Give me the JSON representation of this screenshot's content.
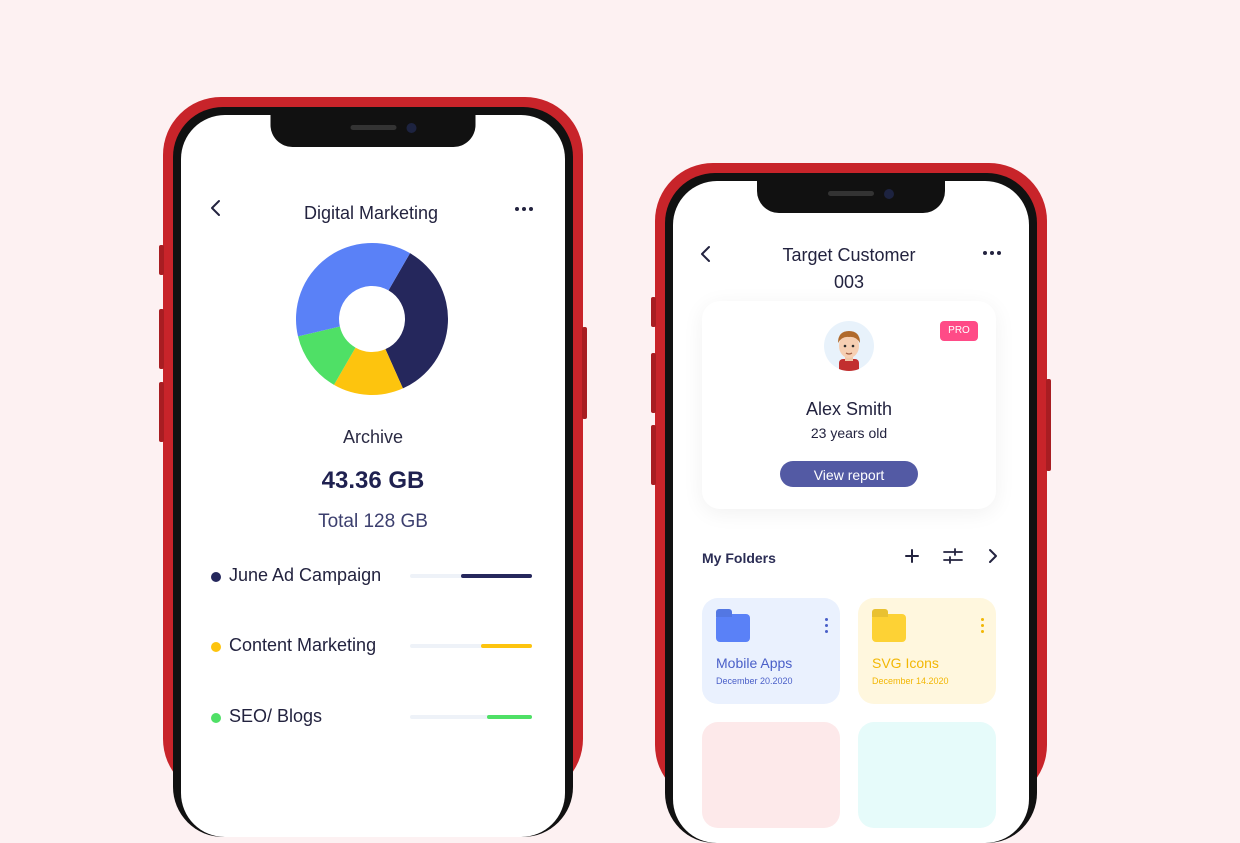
{
  "colors": {
    "background": "#fdf1f2",
    "phone_frame": "#c8242a",
    "navy": "#25275c",
    "blue": "#5a81f7",
    "yellow": "#fdc40e",
    "green": "#4fe066",
    "pro_pink": "#ff4b87",
    "button_purple": "#535aa4"
  },
  "screen1": {
    "back_icon": "chevron-left-icon",
    "title": "Digital Marketing",
    "more_icon": "more-horizontal-icon",
    "archive_label": "Archive",
    "used": "43.36 GB",
    "total": "Total 128 GB",
    "categories": [
      {
        "label": "June Ad Campaign",
        "color": "#25275c",
        "fill": 0.58
      },
      {
        "label": "Content Marketing",
        "color": "#fdc40e",
        "fill": 0.42
      },
      {
        "label": "SEO/ Blogs",
        "color": "#4fe066",
        "fill": 0.37
      }
    ]
  },
  "chart_data": {
    "type": "pie",
    "labels": [
      "",
      "",
      "",
      ""
    ],
    "values": [
      35,
      15,
      13,
      37
    ],
    "colors": [
      "#25275c",
      "#fdc40e",
      "#4fe066",
      "#5a81f7"
    ],
    "style": "donut"
  },
  "screen2": {
    "back_icon": "chevron-left-icon",
    "title_line1": "Target Customer",
    "title_line2": "003",
    "more_icon": "more-horizontal-icon",
    "profile": {
      "badge": "PRO",
      "name": "Alex Smith",
      "age": "23 years old",
      "button": "View report"
    },
    "folders": {
      "title": "My Folders",
      "icons": [
        "plus-icon",
        "sliders-icon",
        "chevron-right-icon"
      ],
      "items": [
        {
          "name": "Mobile Apps",
          "date": "December 20.2020",
          "bg": "#eaf1fe",
          "fg": "#4a5fc8",
          "icon": "#5a81f7"
        },
        {
          "name": "SVG Icons",
          "date": "December 14.2020",
          "bg": "#fff7de",
          "fg": "#f2b705",
          "icon": "#fdd235"
        }
      ]
    }
  }
}
